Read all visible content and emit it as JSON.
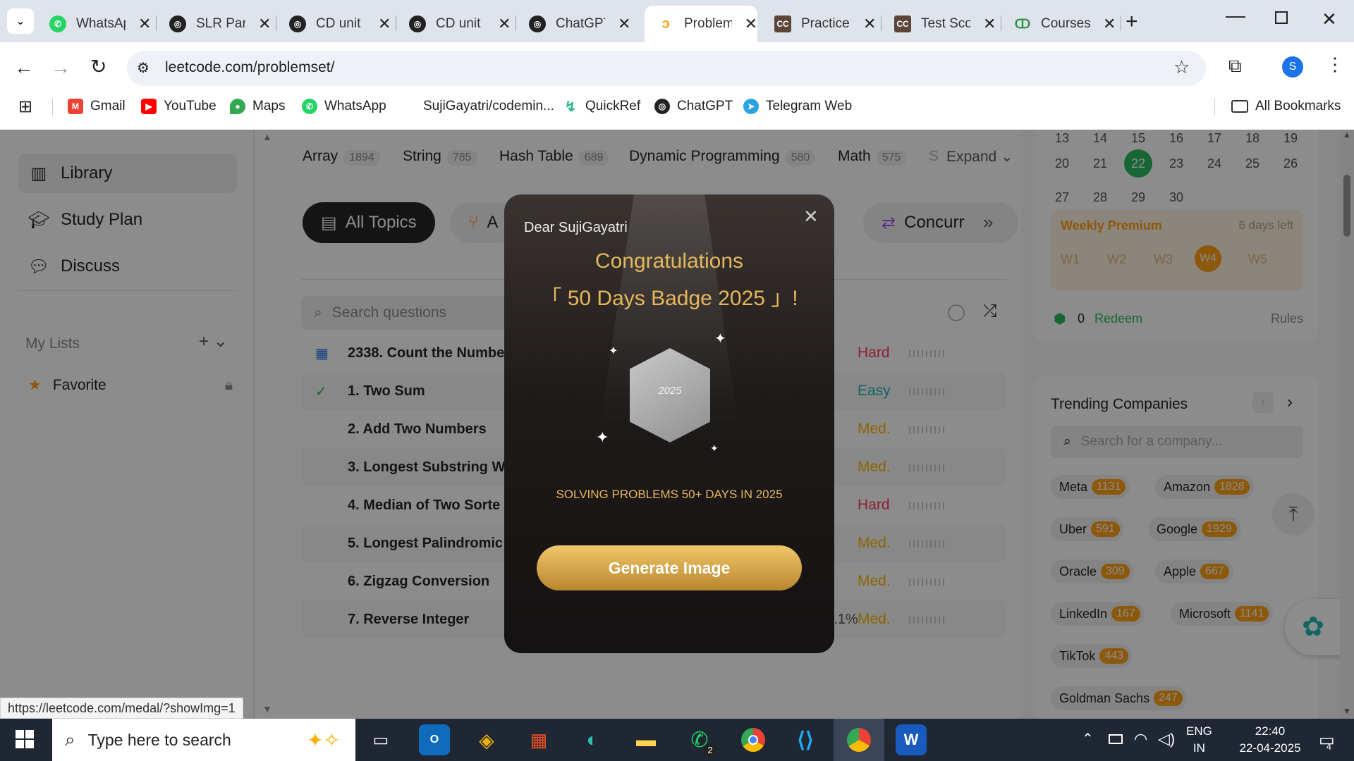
{
  "tabs": [
    {
      "title": "WhatsApp",
      "icon": "whatsapp-icon"
    },
    {
      "title": "SLR Parser",
      "icon": "chatgpt-icon"
    },
    {
      "title": "CD unit",
      "icon": "chatgpt-icon"
    },
    {
      "title": "CD unit",
      "icon": "chatgpt-icon"
    },
    {
      "title": "ChatGPT",
      "icon": "chatgpt-icon"
    },
    {
      "title": "Problems",
      "icon": "leetcode-icon"
    },
    {
      "title": "Practice",
      "icon": "codechef-icon"
    },
    {
      "title": "Test Score",
      "icon": "codechef-icon"
    },
    {
      "title": "Courses",
      "icon": "gfg-icon"
    }
  ],
  "address": {
    "url": "leetcode.com/problemset/",
    "profile_letter": "S"
  },
  "bookmarks": [
    "Gmail",
    "YouTube",
    "Maps",
    "WhatsApp",
    "SujiGayatri/codemin...",
    "QuickRef",
    "ChatGPT",
    "Telegram Web",
    "All Bookmarks"
  ],
  "sidebar": {
    "items": [
      "Library",
      "Study Plan",
      "Discuss"
    ],
    "my_lists": "My Lists",
    "favorite": "Favorite"
  },
  "topics": [
    {
      "name": "Array",
      "count": "1894"
    },
    {
      "name": "String",
      "count": "785"
    },
    {
      "name": "Hash Table",
      "count": "689"
    },
    {
      "name": "Dynamic Programming",
      "count": "580"
    },
    {
      "name": "Math",
      "count": "575"
    },
    {
      "name": "S",
      "count": ""
    }
  ],
  "expand_label": "Expand",
  "filter_pills": {
    "all_topics": "All Topics",
    "second": "A",
    "concurrency": "Concurr"
  },
  "search_placeholder": "Search questions",
  "problems": [
    {
      "title": "2338. Count the Numbe",
      "acceptance": "",
      "difficulty": "Hard",
      "status": "calendar"
    },
    {
      "title": "1. Two Sum",
      "acceptance": "",
      "difficulty": "Easy",
      "status": "check"
    },
    {
      "title": "2. Add Two Numbers",
      "acceptance": "",
      "difficulty": "Med.",
      "status": ""
    },
    {
      "title": "3. Longest Substring W",
      "acceptance": "",
      "difficulty": "Med.",
      "status": ""
    },
    {
      "title": "4. Median of Two Sorte",
      "acceptance": "",
      "difficulty": "Hard",
      "status": ""
    },
    {
      "title": "5. Longest Palindromic",
      "acceptance": "",
      "difficulty": "Med.",
      "status": ""
    },
    {
      "title": "6. Zigzag Conversion",
      "acceptance": "",
      "difficulty": "Med.",
      "status": ""
    },
    {
      "title": "7. Reverse Integer",
      "acceptance": "30.1%",
      "difficulty": "Med.",
      "status": ""
    }
  ],
  "calendar": {
    "row1": [
      "13",
      "14",
      "15",
      "16",
      "17",
      "18",
      "19"
    ],
    "row2": [
      "20",
      "21",
      "22",
      "23",
      "24",
      "25",
      "26"
    ],
    "row3": [
      "27",
      "28",
      "29",
      "30"
    ],
    "today": "22"
  },
  "weekly_premium": {
    "title": "Weekly Premium",
    "days_left": "6 days left",
    "weeks": [
      "W1",
      "W2",
      "W3",
      "W4",
      "W5"
    ],
    "active_week": "W4"
  },
  "redeem": {
    "coins": "0",
    "label": "Redeem",
    "rules": "Rules"
  },
  "trending": {
    "title": "Trending Companies",
    "search_placeholder": "Search for a company...",
    "companies": [
      {
        "name": "Meta",
        "count": "1131"
      },
      {
        "name": "Amazon",
        "count": "1828"
      },
      {
        "name": "Uber",
        "count": "591"
      },
      {
        "name": "Google",
        "count": "1929"
      },
      {
        "name": "Oracle",
        "count": "309"
      },
      {
        "name": "Apple",
        "count": "667"
      },
      {
        "name": "LinkedIn",
        "count": "167"
      },
      {
        "name": "Microsoft",
        "count": "1141"
      },
      {
        "name": "TikTok",
        "count": "443"
      },
      {
        "name": "Goldman Sachs",
        "count": "247"
      }
    ]
  },
  "modal": {
    "greeting": "Dear SujiGayatri",
    "title1": "Congratulations",
    "title2": "「 50 Days Badge 2025 」!",
    "badge_text": "2025",
    "subtitle": "SOLVING PROBLEMS 50+ DAYS IN 2025",
    "button": "Generate Image"
  },
  "status_url": "https://leetcode.com/medal/?showImg=1",
  "taskbar": {
    "search_placeholder": "Type here to search",
    "lang1": "ENG",
    "lang2": "IN",
    "time": "22:40",
    "date": "22-04-2025",
    "notifications": "4",
    "whatsapp_badge": "2"
  },
  "colors": {
    "accent": "#ffa116",
    "easy": "#1cb8b8",
    "medium": "#ffb800",
    "hard": "#ff375f",
    "gold": "#e6b75c"
  }
}
